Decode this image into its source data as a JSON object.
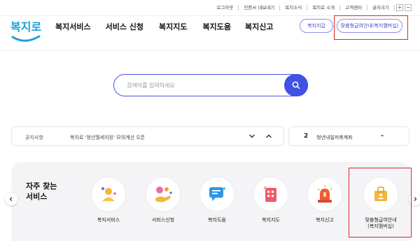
{
  "utility": {
    "items": [
      "로그아웃",
      "인증서 내보내기",
      "복지소식",
      "복지로 소개",
      "고객센터",
      "글자크기"
    ],
    "font_plus": "+",
    "font_minus": "−"
  },
  "header": {
    "logo_text": "복지로",
    "nav": [
      "복지서비스",
      "서비스 신청",
      "복지지도",
      "복지도움",
      "복지신고"
    ],
    "btn_wallet": "복지지갑",
    "btn_custom": "맞춤형급여안내(복지멤버십)"
  },
  "search": {
    "placeholder": "검색어를 입력하세요"
  },
  "notice": {
    "label": "공지사항",
    "text": "복지로 '청년월세지원' 모의계산 오픈"
  },
  "account": {
    "number": "2",
    "text": "청년내일저축계좌",
    "minus": "-"
  },
  "favorites": {
    "title_line1": "자주 찾는",
    "title_line2": "서비스",
    "items": [
      {
        "label": "복지서비스"
      },
      {
        "label": "서비스신청"
      },
      {
        "label": "복지도움"
      },
      {
        "label": "복지지도"
      },
      {
        "label": "복지신고"
      },
      {
        "label_line1": "맞춤형급여안내",
        "label_line2": "(복지멤버십)"
      }
    ]
  },
  "colors": {
    "accent": "#3f52e3",
    "highlight": "#e0252a",
    "logo_blue": "#1aa0d8"
  }
}
